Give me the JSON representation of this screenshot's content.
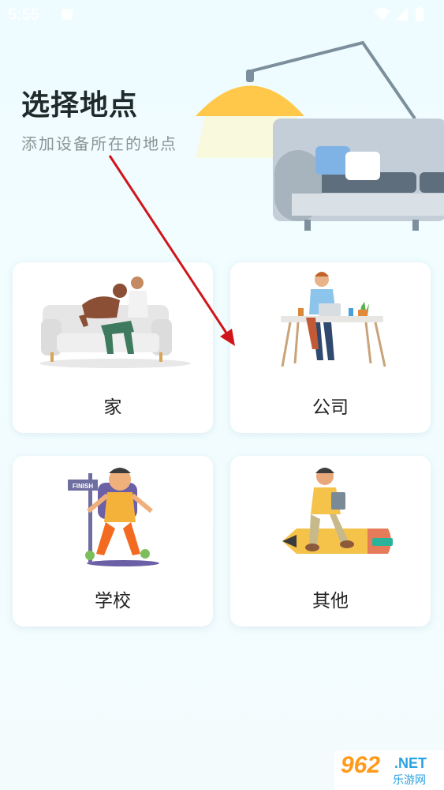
{
  "status_bar": {
    "time": "5:55"
  },
  "header": {
    "title": "选择地点",
    "subtitle": "添加设备所在的地点"
  },
  "locations": [
    {
      "label": "家"
    },
    {
      "label": "公司"
    },
    {
      "label": "学校"
    },
    {
      "label": "其他"
    }
  ],
  "school_sign": "FINISH",
  "watermark": {
    "number": "962",
    "domain": ".NET",
    "name": "乐游网"
  },
  "colors": {
    "lamp": "#ffc84a",
    "sofa": "#c6d2dc",
    "arrow": "#d0161a"
  }
}
